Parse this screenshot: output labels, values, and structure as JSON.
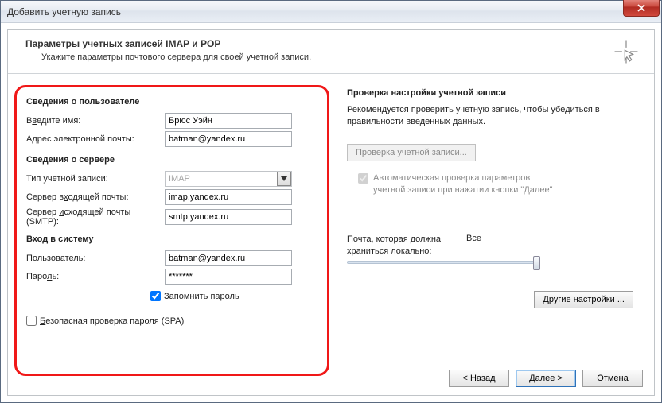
{
  "window": {
    "title": "Добавить учетную запись"
  },
  "header": {
    "title": "Параметры учетных записей IMAP и POP",
    "subtitle": "Укажите параметры почтового сервера для своей учетной записи."
  },
  "left": {
    "section_user": "Сведения о пользователе",
    "name_label_pre": "В",
    "name_label_u": "в",
    "name_label_post": "едите имя:",
    "name_value": "Брюс Уэйн",
    "email_label": "Адрес электронной почты:",
    "email_value": "batman@yandex.ru",
    "section_server": "Сведения о сервере",
    "acct_type_label": "Тип учетной записи:",
    "acct_type_value": "IMAP",
    "incoming_pre": "Сервер в",
    "incoming_u": "х",
    "incoming_post": "одящей почты:",
    "incoming_value": "imap.yandex.ru",
    "outgoing_pre": "Сервер ",
    "outgoing_u": "и",
    "outgoing_post": "сходящей почты (SMTP):",
    "outgoing_value": "smtp.yandex.ru",
    "section_login": "Вход в систему",
    "user_pre": "Пользо",
    "user_u": "в",
    "user_post": "атель:",
    "user_value": "batman@yandex.ru",
    "password_pre": "Паро",
    "password_u": "л",
    "password_post": "ь:",
    "password_value": "*******",
    "remember_pre": "",
    "remember_u": "З",
    "remember_post": "апомнить пароль",
    "spa_pre": "",
    "spa_u": "Б",
    "spa_post": "езопасная проверка пароля (SPA)"
  },
  "right": {
    "section": "Проверка настройки учетной записи",
    "desc": "Рекомендуется проверить учетную запись, чтобы убедиться в правильности введенных данных.",
    "test_btn": "Проверка учетной записи...",
    "auto_pre": "Автоматическая проверка параметров учетной записи при нажатии кнопки \"Далее\"",
    "storage_label": "Почта, которая должна храниться локально:",
    "storage_value": "Все",
    "other_btn": "Другие настройки ..."
  },
  "footer": {
    "back": "< Назад",
    "next": "Далее >",
    "cancel": "Отмена"
  }
}
